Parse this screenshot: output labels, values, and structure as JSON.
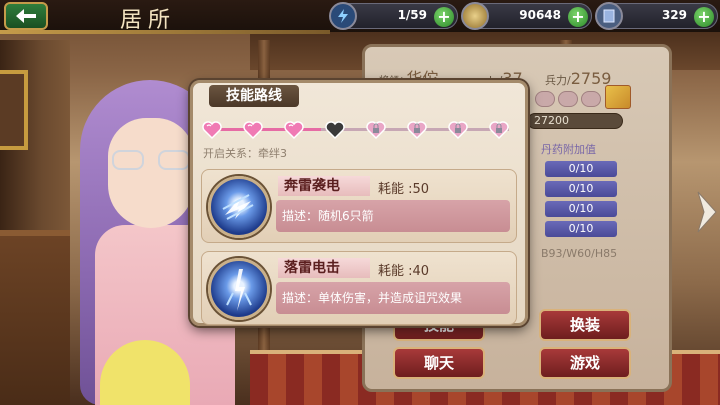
{
  "header": {
    "title": "居所",
    "energy": "1/59",
    "coins": "90648",
    "gems": "329"
  },
  "info": {
    "general_label": "将领/",
    "general_name": "华佗",
    "level_label": "lv/",
    "level": "37",
    "power_label": "兵力/",
    "power": "2759",
    "exp": "27200",
    "pill_header": "丹药附加值",
    "pills": [
      "0/10",
      "0/10",
      "0/10",
      "0/10"
    ],
    "stats": "B93/W60/H85",
    "buttons": {
      "skill": "技能",
      "equip": "换装",
      "chat": "聊天",
      "game": "游戏"
    }
  },
  "skill_popup": {
    "title": "技能路线",
    "bond_text": "开启关系：牵绊3",
    "hearts": [
      "unlocked",
      "unlocked",
      "unlocked",
      "current",
      "locked",
      "locked",
      "locked",
      "locked"
    ],
    "skills": [
      {
        "name": "奔雷袭电",
        "cost_label": "耗能",
        "cost": ":50",
        "desc_label": "描述：",
        "desc": "随机6只箭",
        "icon": "lightning-arrows-icon"
      },
      {
        "name": "落雷电击",
        "cost_label": "耗能",
        "cost": ":40",
        "desc_label": "描述：",
        "desc": "单体伤害，并造成诅咒效果",
        "icon": "lightning-strike-icon"
      }
    ]
  },
  "colors": {
    "accent_gold": "#c59b4a",
    "heart_pink": "#e66ba4",
    "skill_name_red": "#5a1e1e"
  }
}
